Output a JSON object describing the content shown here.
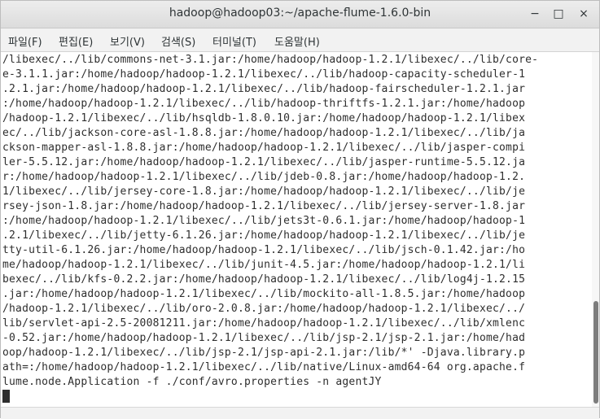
{
  "window": {
    "title": "hadoop@hadoop03:~/apache-flume-1.6.0-bin",
    "buttons": {
      "minimize": "−",
      "maximize": "□",
      "close": "×"
    }
  },
  "menu": [
    "파일(F)",
    "편집(E)",
    "보기(V)",
    "검색(S)",
    "터미널(T)",
    "도움말(H)"
  ],
  "terminal": {
    "lines": [
      "/libexec/../lib/commons-net-3.1.jar:/home/hadoop/hadoop-1.2.1/libexec/../lib/core-",
      "e-3.1.1.jar:/home/hadoop/hadoop-1.2.1/libexec/../lib/hadoop-capacity-scheduler-1",
      ".2.1.jar:/home/hadoop/hadoop-1.2.1/libexec/../lib/hadoop-fairscheduler-1.2.1.jar",
      ":/home/hadoop/hadoop-1.2.1/libexec/../lib/hadoop-thriftfs-1.2.1.jar:/home/hadoop",
      "/hadoop-1.2.1/libexec/../lib/hsqldb-1.8.0.10.jar:/home/hadoop/hadoop-1.2.1/libex",
      "ec/../lib/jackson-core-asl-1.8.8.jar:/home/hadoop/hadoop-1.2.1/libexec/../lib/ja",
      "ckson-mapper-asl-1.8.8.jar:/home/hadoop/hadoop-1.2.1/libexec/../lib/jasper-compi",
      "ler-5.5.12.jar:/home/hadoop/hadoop-1.2.1/libexec/../lib/jasper-runtime-5.5.12.ja",
      "r:/home/hadoop/hadoop-1.2.1/libexec/../lib/jdeb-0.8.jar:/home/hadoop/hadoop-1.2.",
      "1/libexec/../lib/jersey-core-1.8.jar:/home/hadoop/hadoop-1.2.1/libexec/../lib/je",
      "rsey-json-1.8.jar:/home/hadoop/hadoop-1.2.1/libexec/../lib/jersey-server-1.8.jar",
      ":/home/hadoop/hadoop-1.2.1/libexec/../lib/jets3t-0.6.1.jar:/home/hadoop/hadoop-1",
      ".2.1/libexec/../lib/jetty-6.1.26.jar:/home/hadoop/hadoop-1.2.1/libexec/../lib/je",
      "tty-util-6.1.26.jar:/home/hadoop/hadoop-1.2.1/libexec/../lib/jsch-0.1.42.jar:/ho",
      "me/hadoop/hadoop-1.2.1/libexec/../lib/junit-4.5.jar:/home/hadoop/hadoop-1.2.1/li",
      "bexec/../lib/kfs-0.2.2.jar:/home/hadoop/hadoop-1.2.1/libexec/../lib/log4j-1.2.15",
      ".jar:/home/hadoop/hadoop-1.2.1/libexec/../lib/mockito-all-1.8.5.jar:/home/hadoop",
      "/hadoop-1.2.1/libexec/../lib/oro-2.0.8.jar:/home/hadoop/hadoop-1.2.1/libexec/../",
      "lib/servlet-api-2.5-20081211.jar:/home/hadoop/hadoop-1.2.1/libexec/../lib/xmlenc",
      "-0.52.jar:/home/hadoop/hadoop-1.2.1/libexec/../lib/jsp-2.1/jsp-2.1.jar:/home/had",
      "oop/hadoop-1.2.1/libexec/../lib/jsp-2.1/jsp-api-2.1.jar:/lib/*' -Djava.library.p",
      "ath=:/home/hadoop/hadoop-1.2.1/libexec/../lib/native/Linux-amd64-64 org.apache.f",
      "lume.node.Application -f ./conf/avro.properties -n agentJY"
    ]
  }
}
